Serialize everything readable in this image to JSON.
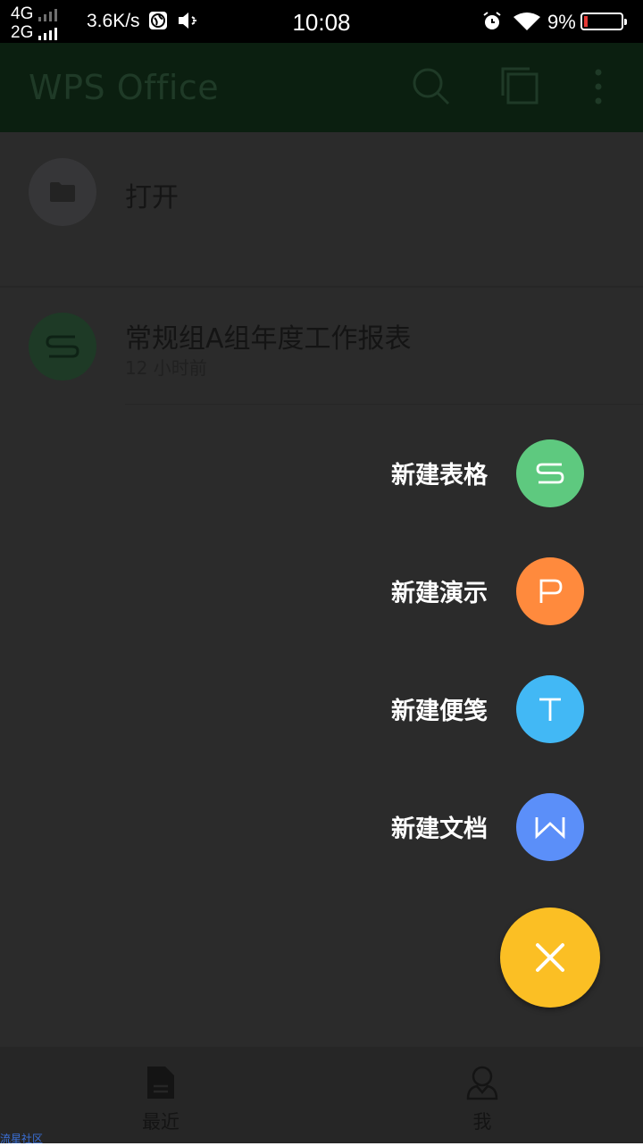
{
  "status_bar": {
    "network_1": "4G",
    "network_2": "2G",
    "speed": "3.6K/s",
    "time": "10:08",
    "battery_percent": "9%",
    "battery_level": 0.09
  },
  "app_bar": {
    "title": "WPS Office",
    "icons": [
      "search-icon",
      "multi-window-icon",
      "more-vertical-icon"
    ]
  },
  "list": {
    "open_label": "打开",
    "files": [
      {
        "name": "常规组A组年度工作报表",
        "time": "12 小时前",
        "type_icon": "spreadsheet-s-icon"
      }
    ]
  },
  "fab_menu": {
    "items": [
      {
        "label": "新建表格",
        "letter_icon": "s-icon",
        "color": "#5ec97f"
      },
      {
        "label": "新建演示",
        "letter_icon": "p-icon",
        "color": "#ff8a3d"
      },
      {
        "label": "新建便笺",
        "letter_icon": "t-icon",
        "color": "#42b8f5"
      },
      {
        "label": "新建文档",
        "letter_icon": "w-icon",
        "color": "#5b8ff9"
      }
    ],
    "close_icon": "close-icon",
    "close_color": "#fbbf24"
  },
  "bottom_nav": {
    "recent_label": "最近",
    "me_label": "我"
  },
  "watermark": "流星社区"
}
